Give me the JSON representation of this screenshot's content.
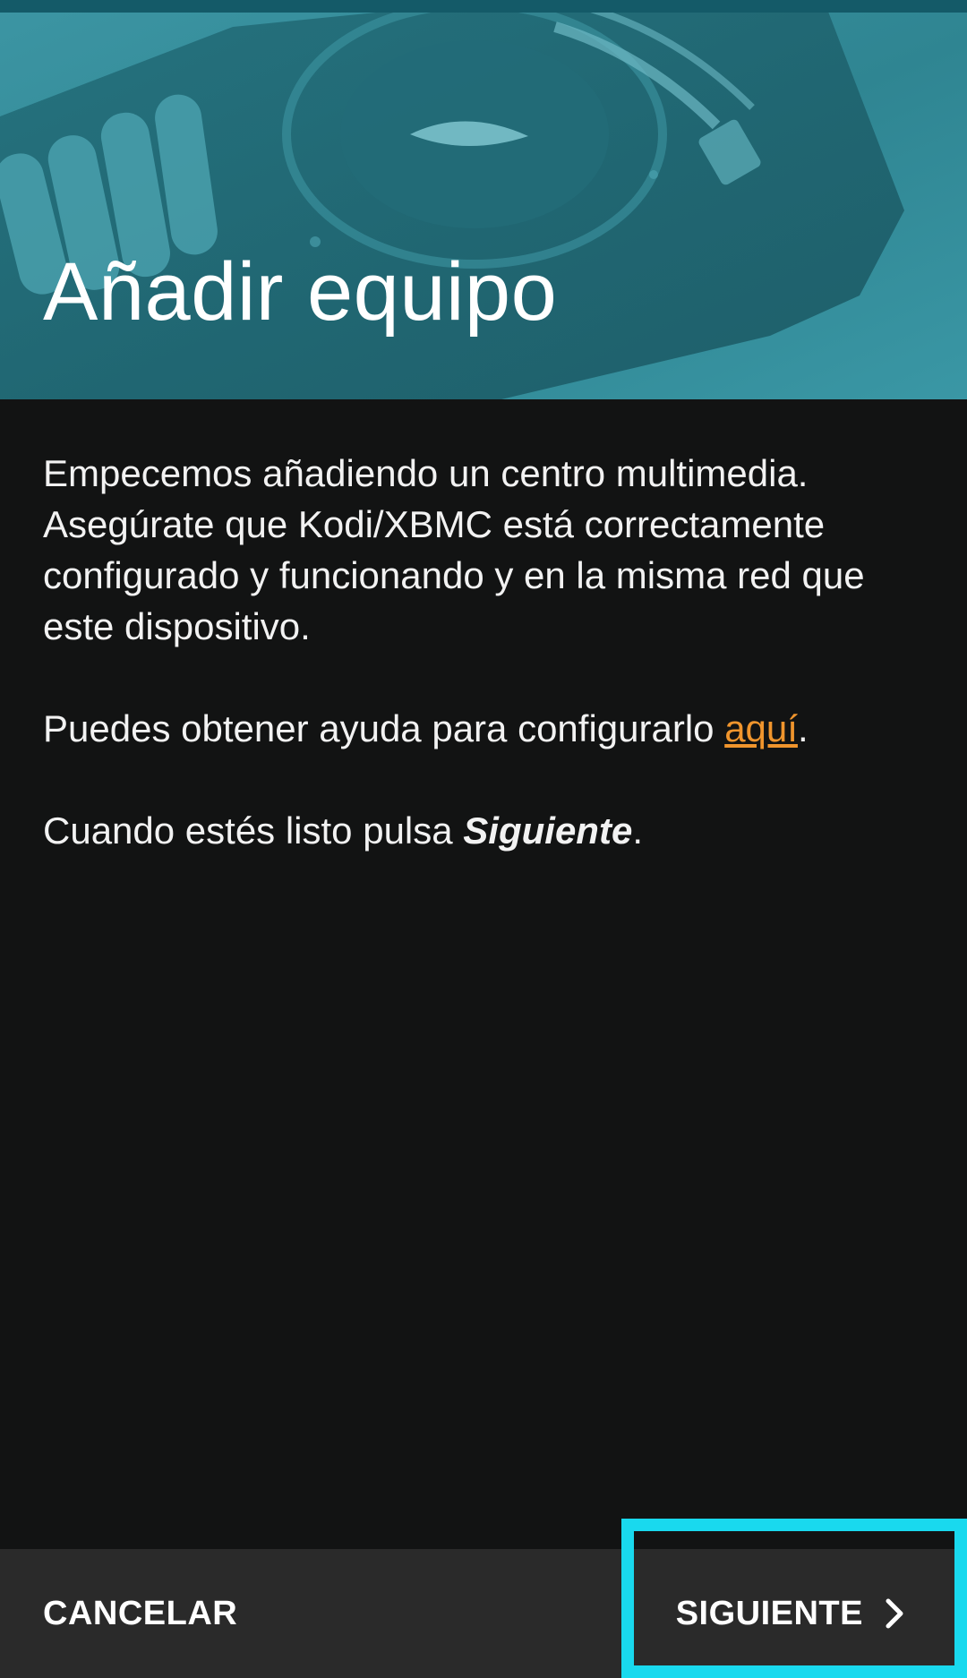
{
  "header": {
    "title": "Añadir equipo",
    "image_icon": "tv-remote-artwork"
  },
  "content": {
    "intro": "Empecemos añadiendo un centro multimedia. Asegúrate que Kodi/XBMC está correctamente configurado y funcionando y en la misma red que este dispositivo.",
    "help_prefix": "Puedes obtener ayuda para configurarlo ",
    "help_link": "aquí",
    "help_suffix": ".",
    "ready_prefix": "Cuando estés listo pulsa ",
    "ready_emphasis": "Siguiente",
    "ready_suffix": "."
  },
  "actions": {
    "cancel_label": "CANCELAR",
    "next_label": "SIGUIENTE",
    "next_icon": "chevron-right-icon"
  },
  "colors": {
    "header_teal": "#2f8795",
    "background": "#121313",
    "bottom_bar": "#2a2a2a",
    "link": "#f0952d",
    "highlight": "#19d9ee"
  }
}
